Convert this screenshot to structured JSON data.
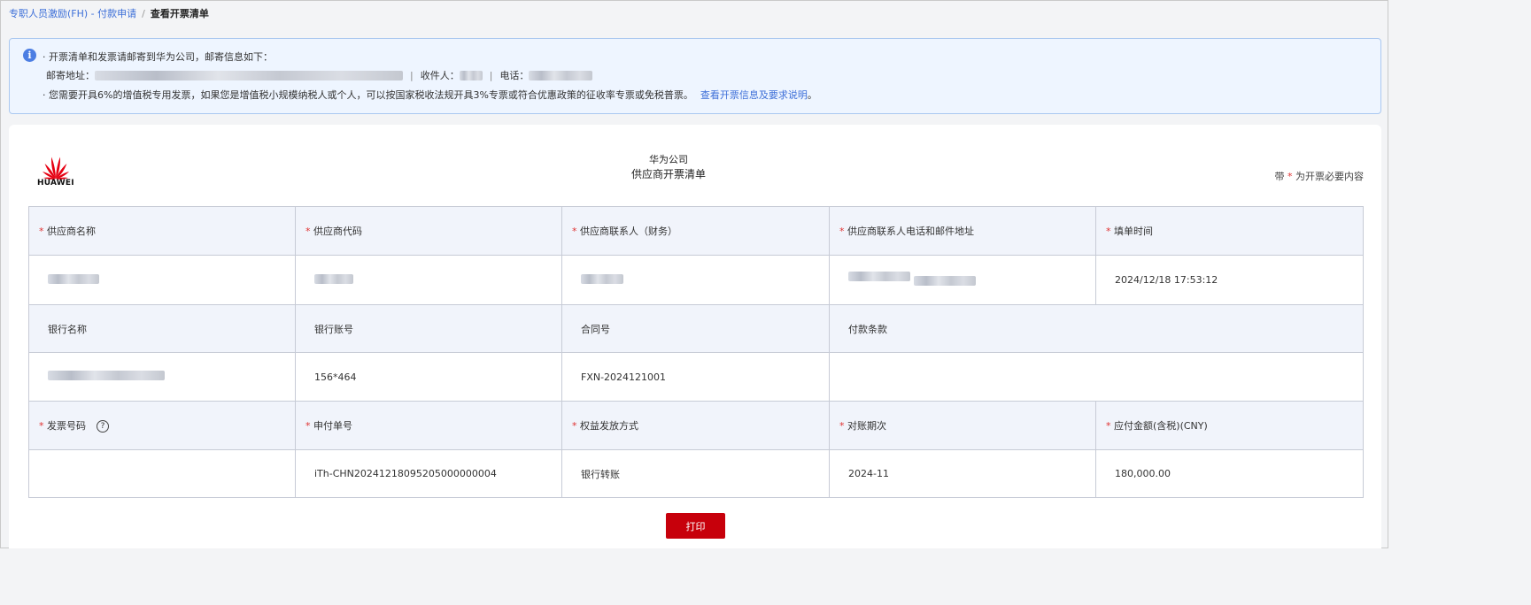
{
  "breadcrumb": {
    "parent": "专职人员激励(FH) - 付款申请",
    "separator": "/",
    "current": "查看开票清单"
  },
  "notice": {
    "line1": "· 开票清单和发票请邮寄到华为公司，邮寄信息如下：",
    "address_label": "邮寄地址：",
    "receiver_label": "收件人：",
    "phone_label": "电话：",
    "separator": "|",
    "line3": "· 您需要开具6%的增值税专用发票，如果您是增值税小规模纳税人或个人，可以按国家税收法规开具3%专票或符合优惠政策的征收率专票或免税普票。",
    "link": "查看开票信息及要求说明",
    "link_suffix": "。"
  },
  "header": {
    "logo_text": "HUAWEI",
    "company": "华为公司",
    "title": "供应商开票清单",
    "hint_prefix": "带",
    "hint_star": "*",
    "hint_suffix": "为开票必要内容"
  },
  "table": {
    "row1": [
      "供应商名称",
      "供应商代码",
      "供应商联系人（财务）",
      "供应商联系人电话和邮件地址",
      "填单时间"
    ],
    "fill_time": "2024/12/18 17:53:12",
    "row3": [
      "银行名称",
      "银行账号",
      "合同号",
      "付款条款"
    ],
    "bank_account": "156*464",
    "contract_no": "FXN-2024121001",
    "row5": [
      "发票号码",
      "申付单号",
      "权益发放方式",
      "对账期次",
      "应付金额(含税)(CNY)"
    ],
    "invoice_no": "",
    "payment_no": "iTh-CHN20241218095205000000004",
    "payout_method": "银行转账",
    "period": "2024-11",
    "amount": "180,000.00"
  },
  "buttons": {
    "print": "打印"
  },
  "colors": {
    "accent_red": "#c7000b",
    "link_blue": "#3d6fd8",
    "notice_bg": "#eef5ff",
    "header_row_bg": "#f1f4fb"
  },
  "icons": [
    "info-icon",
    "help-icon",
    "huawei-logo"
  ]
}
